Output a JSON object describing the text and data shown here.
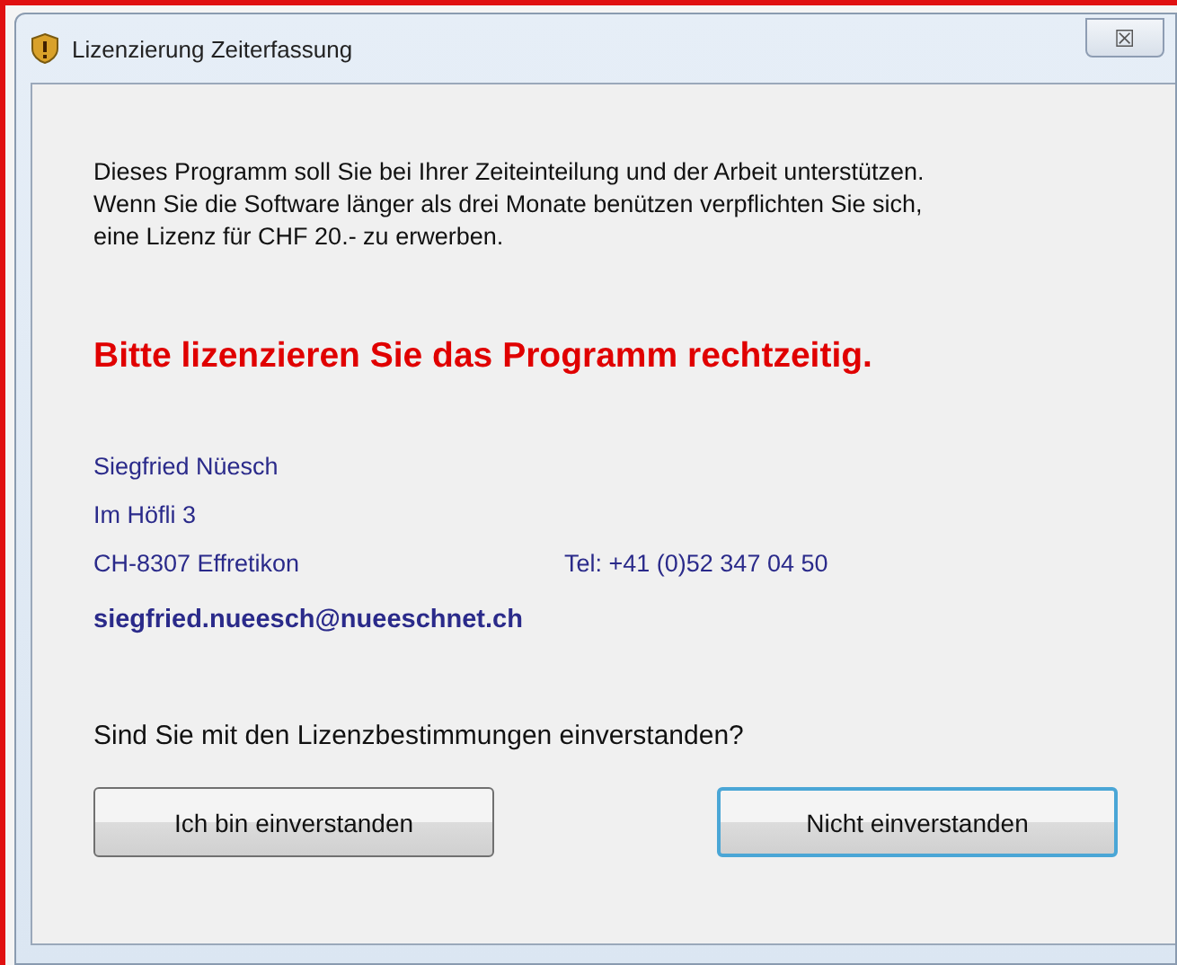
{
  "window": {
    "title": "Lizenzierung Zeiterfassung",
    "close_label": "☒"
  },
  "intro_lines": [
    "Dieses Programm soll Sie bei Ihrer Zeiteinteilung und der Arbeit unterstützen.",
    "Wenn Sie die Software länger als drei Monate benützen verpflichten Sie sich,",
    "eine Lizenz für CHF 20.- zu erwerben."
  ],
  "warning": "Bitte lizenzieren Sie das Programm rechtzeitig.",
  "contact": {
    "name": "Siegfried Nüesch",
    "street": "Im Höfli 3",
    "city": "CH-8307 Effretikon",
    "phone": "Tel: +41 (0)52 347 04 50",
    "email": "siegfried.nueesch@nueeschnet.ch"
  },
  "question": "Sind Sie mit den Lizenzbestimmungen einverstanden?",
  "buttons": [
    {
      "label": "Ich bin einverstanden",
      "focused": false
    },
    {
      "label": "Nicht einverstanden",
      "focused": true
    }
  ]
}
